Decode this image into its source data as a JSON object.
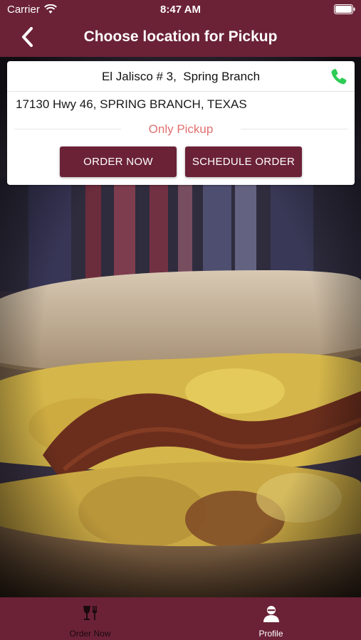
{
  "status_bar": {
    "carrier": "Carrier",
    "time": "8:47 AM"
  },
  "header": {
    "title": "Choose location for Pickup"
  },
  "location": {
    "name": "El Jalisco # 3,  Spring Branch",
    "address": "17130 Hwy 46, SPRING BRANCH, TEXAS",
    "mode": "Only Pickup",
    "order_now_label": "ORDER NOW",
    "schedule_order_label": "SCHEDULE ORDER"
  },
  "tabs": [
    {
      "label": "Order Now",
      "icon": "utensils-icon"
    },
    {
      "label": "Profile",
      "icon": "user-icon"
    }
  ],
  "colors": {
    "brand": "#6b2237",
    "phone": "#2ecc55",
    "pickup_text": "#e07070"
  }
}
